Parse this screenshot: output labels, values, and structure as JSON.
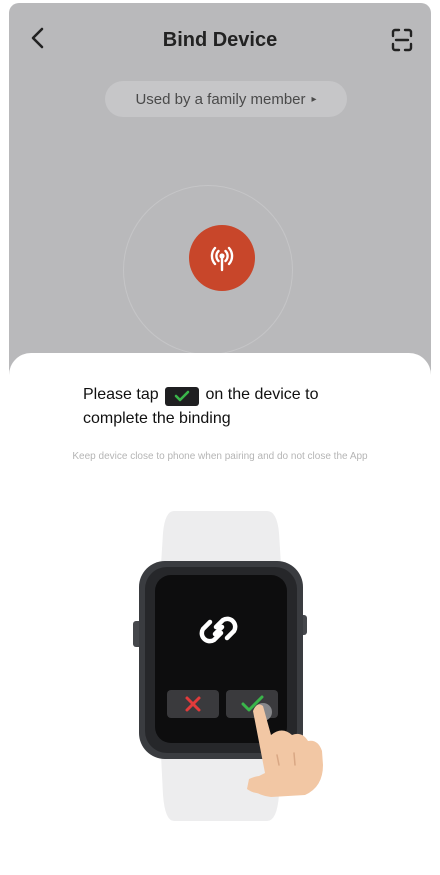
{
  "header": {
    "title": "Bind Device",
    "back_icon": "back-chevron-icon",
    "scan_icon": "scan-icon"
  },
  "family_link": {
    "label": "Used by a family member",
    "arrow": "▸"
  },
  "pairing": {
    "signal_icon": "signal-tower-icon",
    "accent_color": "#c8462a"
  },
  "sheet": {
    "instruction_before": "Please tap",
    "instruction_after": "on the device to complete the binding",
    "hint": "Keep device close to phone when pairing and do not close the App"
  },
  "colors": {
    "backdrop": "#b9b9bb",
    "confirm": "#3ab54a",
    "cancel": "#e23b3b"
  }
}
